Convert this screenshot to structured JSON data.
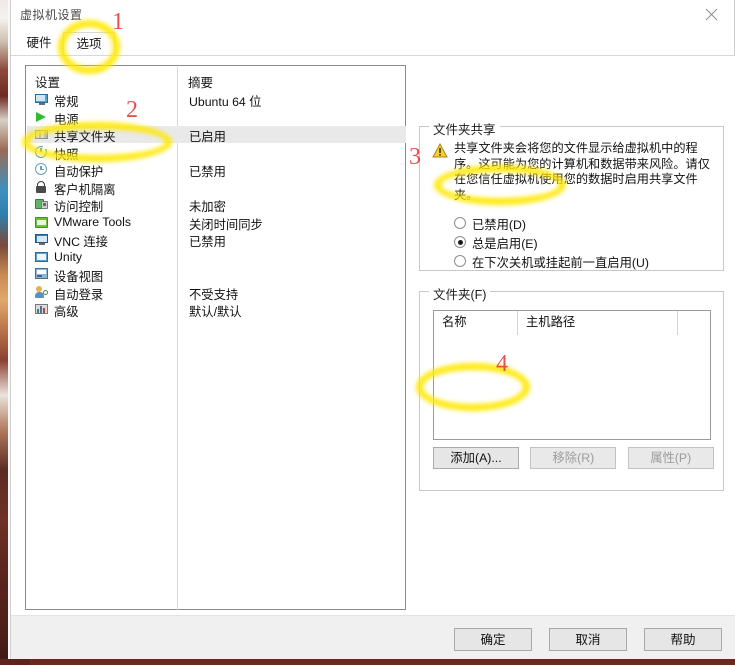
{
  "window": {
    "title": "虚拟机设置",
    "close_icon": "close-icon"
  },
  "tabs": [
    {
      "label": "硬件",
      "active": false
    },
    {
      "label": "选项",
      "active": true
    }
  ],
  "settings_list": {
    "header_setting": "设置",
    "header_summary": "摘要",
    "rows": [
      {
        "icon": "monitor-icon",
        "label": "常规",
        "summary": "Ubuntu 64 位",
        "selected": false
      },
      {
        "icon": "play-icon",
        "label": "电源",
        "summary": "",
        "selected": false
      },
      {
        "icon": "folder-icon",
        "label": "共享文件夹",
        "summary": "已启用",
        "selected": true
      },
      {
        "icon": "camera-icon",
        "label": "快照",
        "summary": "",
        "selected": false
      },
      {
        "icon": "clock-icon",
        "label": "自动保护",
        "summary": "已禁用",
        "selected": false
      },
      {
        "icon": "lock-icon",
        "label": "客户机隔离",
        "summary": "",
        "selected": false
      },
      {
        "icon": "shield-lock-icon",
        "label": "访问控制",
        "summary": "未加密",
        "selected": false
      },
      {
        "icon": "vmware-tools-icon",
        "label": "VMware Tools",
        "summary": "关闭时间同步",
        "selected": false
      },
      {
        "icon": "vnc-icon",
        "label": "VNC 连接",
        "summary": "已禁用",
        "selected": false
      },
      {
        "icon": "unity-icon",
        "label": "Unity",
        "summary": "",
        "selected": false
      },
      {
        "icon": "device-view-icon",
        "label": "设备视图",
        "summary": "",
        "selected": false
      },
      {
        "icon": "user-icon",
        "label": "自动登录",
        "summary": "不受支持",
        "selected": false
      },
      {
        "icon": "advanced-icon",
        "label": "高级",
        "summary": "默认/默认",
        "selected": false
      }
    ]
  },
  "folder_sharing": {
    "legend": "文件夹共享",
    "warning_icon": "warning-triangle-icon",
    "warning_text": "共享文件夹会将您的文件显示给虚拟机中的程序。这可能为您的计算机和数据带来风险。请仅在您信任虚拟机使用您的数据时启用共享文件夹。",
    "options": [
      {
        "label": "已禁用(D)",
        "selected": false
      },
      {
        "label": "总是启用(E)",
        "selected": true
      },
      {
        "label": "在下次关机或挂起前一直启用(U)",
        "selected": false
      }
    ]
  },
  "folders": {
    "legend": "文件夹(F)",
    "columns": [
      "名称",
      "主机路径",
      ""
    ],
    "rows": [],
    "buttons": [
      {
        "label": "添加(A)...",
        "enabled": true
      },
      {
        "label": "移除(R)",
        "enabled": false
      },
      {
        "label": "属性(P)",
        "enabled": false
      }
    ]
  },
  "footer": {
    "buttons": [
      {
        "label": "确定"
      },
      {
        "label": "取消"
      },
      {
        "label": "帮助"
      }
    ]
  },
  "annotations": {
    "color": "#e23a3a",
    "highlight_color": "#ffe800",
    "markers": [
      {
        "number": "1",
        "target": "options-tab"
      },
      {
        "number": "2",
        "target": "shared-folders-row"
      },
      {
        "number": "3",
        "target": "always-enabled-radio"
      },
      {
        "number": "4",
        "target": "add-folder-button"
      }
    ]
  }
}
